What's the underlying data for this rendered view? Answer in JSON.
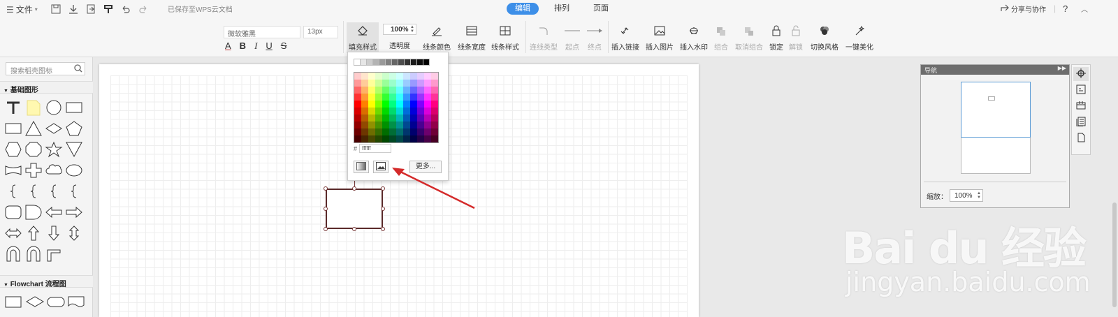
{
  "topbar": {
    "menu_label": "文件",
    "saved_status": "已保存至WPS云文档",
    "share_label": "分享与协作",
    "help_label": "?"
  },
  "tabs": [
    {
      "label": "编辑"
    },
    {
      "label": "排列"
    },
    {
      "label": "页面"
    }
  ],
  "ribbon": {
    "font_family": "微软雅黑",
    "font_size": "13px",
    "opacity_value": "100%",
    "buttons": {
      "fill_style": "填充样式",
      "opacity": "透明度",
      "line_color": "线条颜色",
      "line_width": "线条宽度",
      "line_style": "线条样式",
      "connector_type": "连线类型",
      "start": "起点",
      "end": "终点",
      "insert_link": "插入链接",
      "insert_image": "插入图片",
      "insert_watermark": "插入水印",
      "group": "组合",
      "ungroup": "取消组合",
      "lock": "锁定",
      "unlock": "解锁",
      "switch_style": "切换风格",
      "beautify": "一键美化"
    }
  },
  "leftpanel": {
    "search_placeholder": "搜索稻壳图标",
    "section_basic": "基础图形",
    "section_flowchart": "Flowchart 流程图",
    "basic_shapes": [
      "text",
      "note",
      "circle",
      "rect",
      "rect",
      "triangle",
      "diamond",
      "pentagon",
      "hexagon",
      "octagon",
      "star",
      "inverted-triangle",
      "tape",
      "cross",
      "cloud",
      "ellipse",
      "brace",
      "brace",
      "brace",
      "brace",
      "rounded-rect",
      "d-shape",
      "left-arrow",
      "right-arrow",
      "left-right-arrow",
      "up-arrow",
      "down-arrow",
      "up-down-arrow",
      "u-turn",
      "u-turn",
      "corner-arrow"
    ]
  },
  "color_popup": {
    "hex_prefix": "#",
    "hex_value": "ffffff",
    "more_label": "更多...",
    "grays": [
      "#ffffff",
      "#e6e6e6",
      "#cccccc",
      "#b3b3b3",
      "#999999",
      "#808080",
      "#666666",
      "#4d4d4d",
      "#333333",
      "#1a1a1a",
      "#0d0d0d",
      "#000000"
    ],
    "hues": [
      "#ff0000",
      "#ff8000",
      "#ffff00",
      "#80ff00",
      "#00ff00",
      "#00ff80",
      "#00ffff",
      "#0080ff",
      "#0000ff",
      "#8000ff",
      "#ff00ff",
      "#ff0080"
    ]
  },
  "navigator": {
    "title": "导航",
    "zoom_label": "缩放：",
    "zoom_value": "100%"
  },
  "watermark": {
    "brand": "Bai du 经验",
    "url": "jingyan.baidu.com"
  },
  "colors": {
    "accent": "#3d8fe8",
    "arrow": "#d42a2a",
    "shape_border": "#5a2a2a"
  }
}
